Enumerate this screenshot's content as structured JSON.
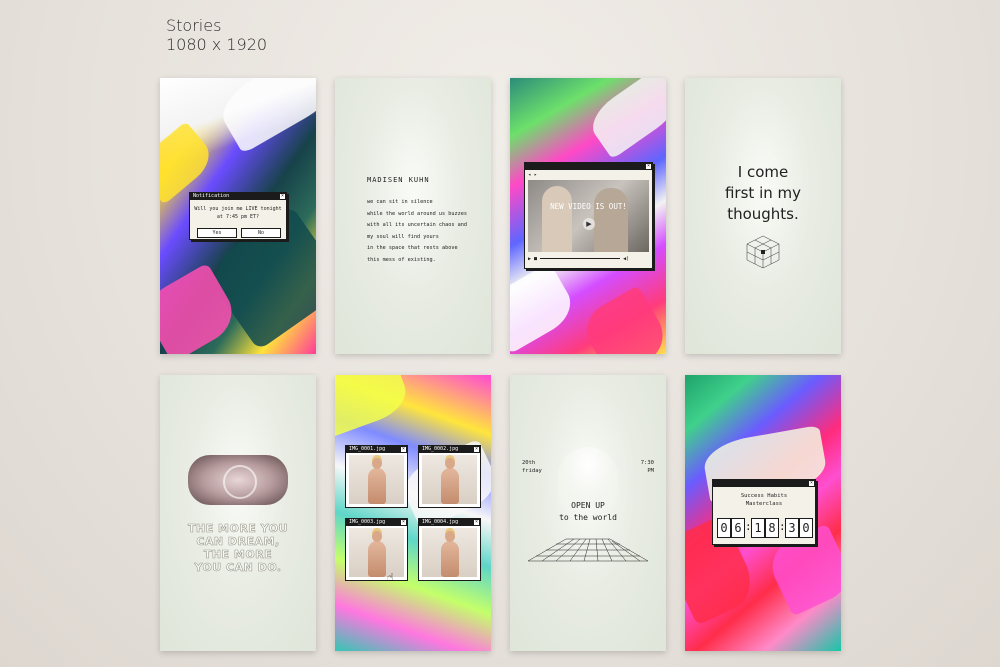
{
  "header": {
    "title": "Stories",
    "size": "1080 x 1920"
  },
  "card1": {
    "dialog_title": "Notification",
    "dialog_text_1": "Will you join me LIVE tonight",
    "dialog_text_2": "at 7:45 pm ET?",
    "yes_label": "Yes",
    "no_label": "No"
  },
  "card2": {
    "title": "MADISEN KUHN",
    "poem": "we can sit in silence\nwhile the world around us buzzes\nwith all its uncertain chaos and\nmy soul will find yours\nin the space that rests above\nthis mess of existing."
  },
  "card3": {
    "video_text": "NEW VIDEO IS OUT!"
  },
  "card4": {
    "quote_1": "I come",
    "quote_2": "first in my",
    "quote_3": "thoughts."
  },
  "card5": {
    "line_1": "THE MORE YOU",
    "line_2": "CAN DREAM,",
    "line_3": "THE MORE",
    "line_4": "YOU CAN DO."
  },
  "card6": {
    "photos": [
      "IMG_0001.jpg",
      "IMG_0002.jpg",
      "IMG_0003.jpg",
      "IMG_0004.jpg"
    ]
  },
  "card7": {
    "date": "20th",
    "day": "friday",
    "time": "7:30",
    "ampm": "PM",
    "line_1": "OPEN UP",
    "line_2": "to the world"
  },
  "card8": {
    "title_1": "Success Habits",
    "title_2": "Masterclass",
    "digits": [
      "0",
      "6",
      "1",
      "8",
      "3",
      "0"
    ]
  }
}
